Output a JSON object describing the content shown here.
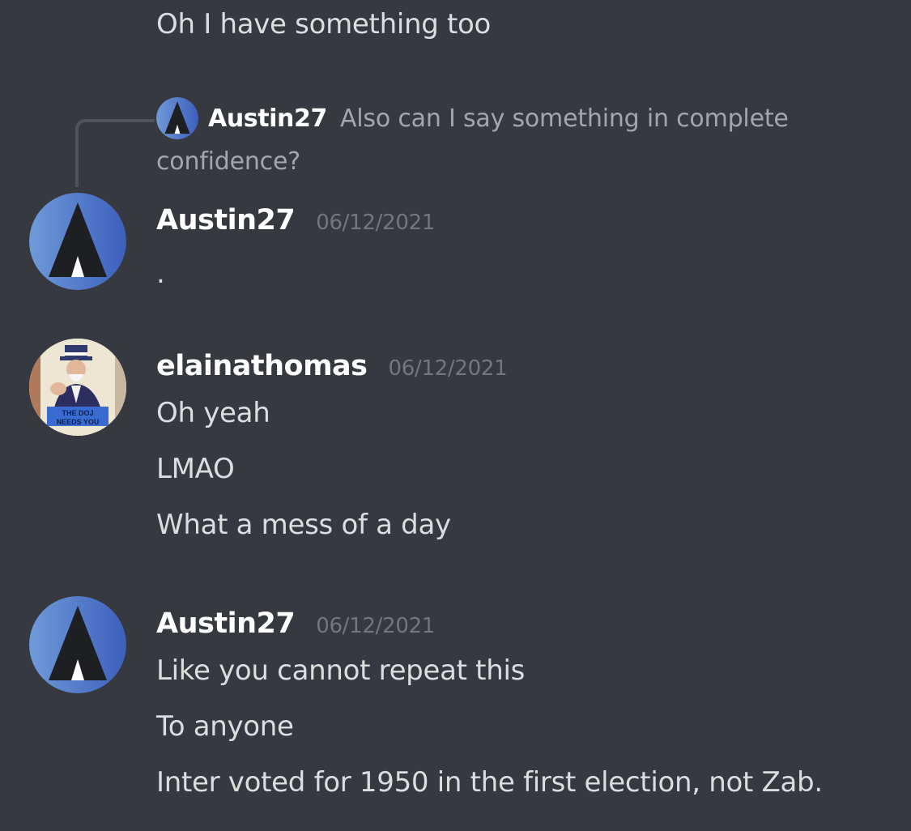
{
  "messages_top": {
    "continuation_text": "Oh I have something too"
  },
  "reply": {
    "author": "Austin27",
    "preview_line1": "Also can I say something in complete",
    "preview_line2": "confidence?"
  },
  "groups": [
    {
      "author": "Austin27",
      "timestamp": "06/12/2021",
      "lines": [
        "."
      ]
    },
    {
      "author": "elainathomas",
      "timestamp": "06/12/2021",
      "avatar_caption_1": "THE DOJ",
      "avatar_caption_2": "NEEDS YOU",
      "lines": [
        "Oh yeah",
        "LMAO",
        "What a mess of a day"
      ]
    },
    {
      "author": "Austin27",
      "timestamp": "06/12/2021",
      "lines": [
        "Like you cannot repeat this",
        "To anyone",
        "Inter voted for 1950 in the first election, not Zab."
      ]
    }
  ],
  "colors": {
    "background": "#36393f",
    "text": "#dcddde",
    "timestamp": "#72767d",
    "avatar_blue": "#4a74c9"
  }
}
